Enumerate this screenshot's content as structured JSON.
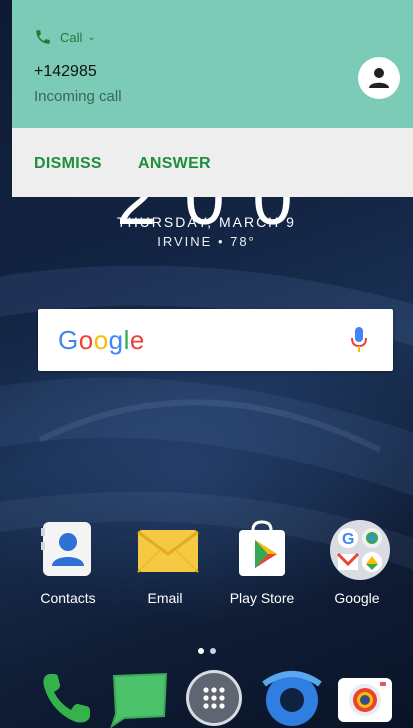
{
  "notification": {
    "app_label": "Call",
    "app_chevron": "⌄",
    "caller_number": "+142985",
    "status_text": "Incoming call",
    "icon": "phone-icon",
    "avatar_icon": "person-icon",
    "accent_color": "#1e8f3a",
    "background_color": "#7ccbb7",
    "actions": {
      "dismiss_label": "DISMISS",
      "answer_label": "ANSWER"
    }
  },
  "lock_widget": {
    "clock_visible_fragment": "2 0 0",
    "date": "THURSDAY, MARCH 9",
    "weather": "IRVINE • 78°"
  },
  "search_bar": {
    "logo_letters": [
      "G",
      "o",
      "o",
      "g",
      "l",
      "e"
    ],
    "mic_icon": "microphone-icon"
  },
  "apps": [
    {
      "label": "Contacts",
      "icon": "contacts-icon"
    },
    {
      "label": "Email",
      "icon": "email-icon"
    },
    {
      "label": "Play Store",
      "icon": "play-store-icon"
    },
    {
      "label": "Google",
      "icon": "google-folder-icon"
    }
  ],
  "page_indicator": {
    "count": 2,
    "active": 0
  },
  "dock": [
    {
      "icon": "phone-icon"
    },
    {
      "icon": "messages-icon"
    },
    {
      "icon": "app-drawer-icon"
    },
    {
      "icon": "internet-icon"
    },
    {
      "icon": "camera-icon"
    }
  ]
}
